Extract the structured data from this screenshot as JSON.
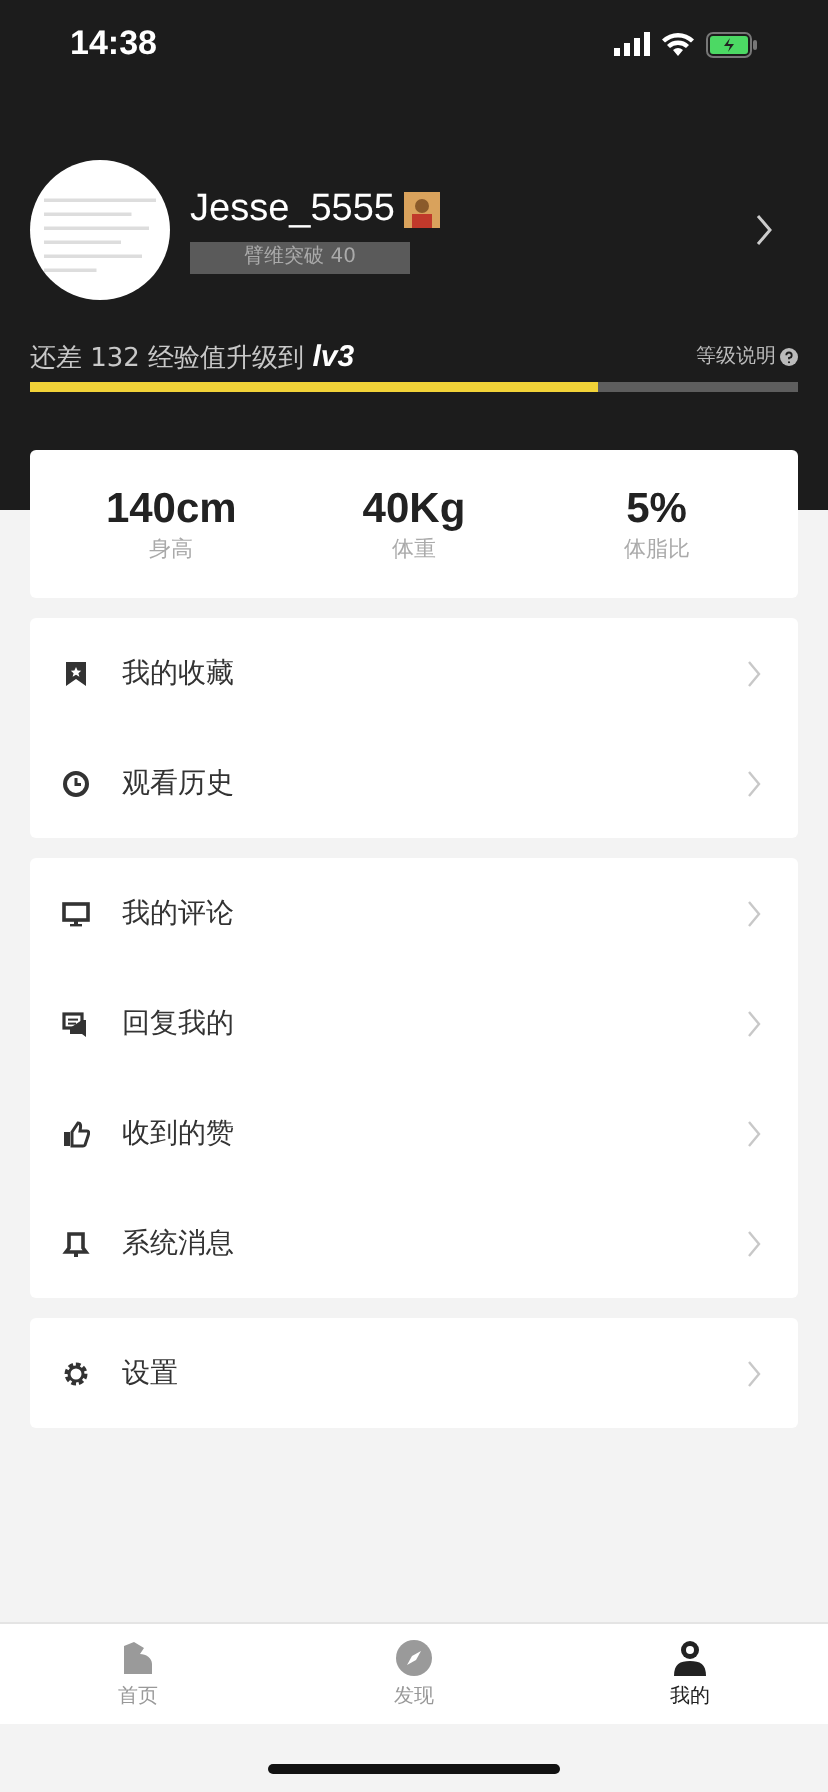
{
  "status_bar": {
    "time": "14:38"
  },
  "profile": {
    "username": "Jesse_5555",
    "badge": "臂维突破 40"
  },
  "level": {
    "prefix": "还差 132 经验值升级到 ",
    "target": "lv3",
    "help": "等级说明",
    "level": 0.74
  },
  "stats": [
    {
      "value": "140cm",
      "label": "身高"
    },
    {
      "value": "40Kg",
      "label": "体重"
    },
    {
      "value": "5%",
      "label": "体脂比"
    }
  ],
  "menu_groups": [
    [
      {
        "label": "我的收藏"
      },
      {
        "label": "观看历史"
      }
    ],
    [
      {
        "label": "我的评论"
      },
      {
        "label": "回复我的"
      },
      {
        "label": "收到的赞"
      },
      {
        "label": "系统消息"
      }
    ],
    [
      {
        "label": "设置"
      }
    ]
  ],
  "tab_bar": [
    {
      "label": "首页",
      "selected": false
    },
    {
      "label": "发现",
      "selected": false
    },
    {
      "label": "我的",
      "selected": true
    }
  ]
}
